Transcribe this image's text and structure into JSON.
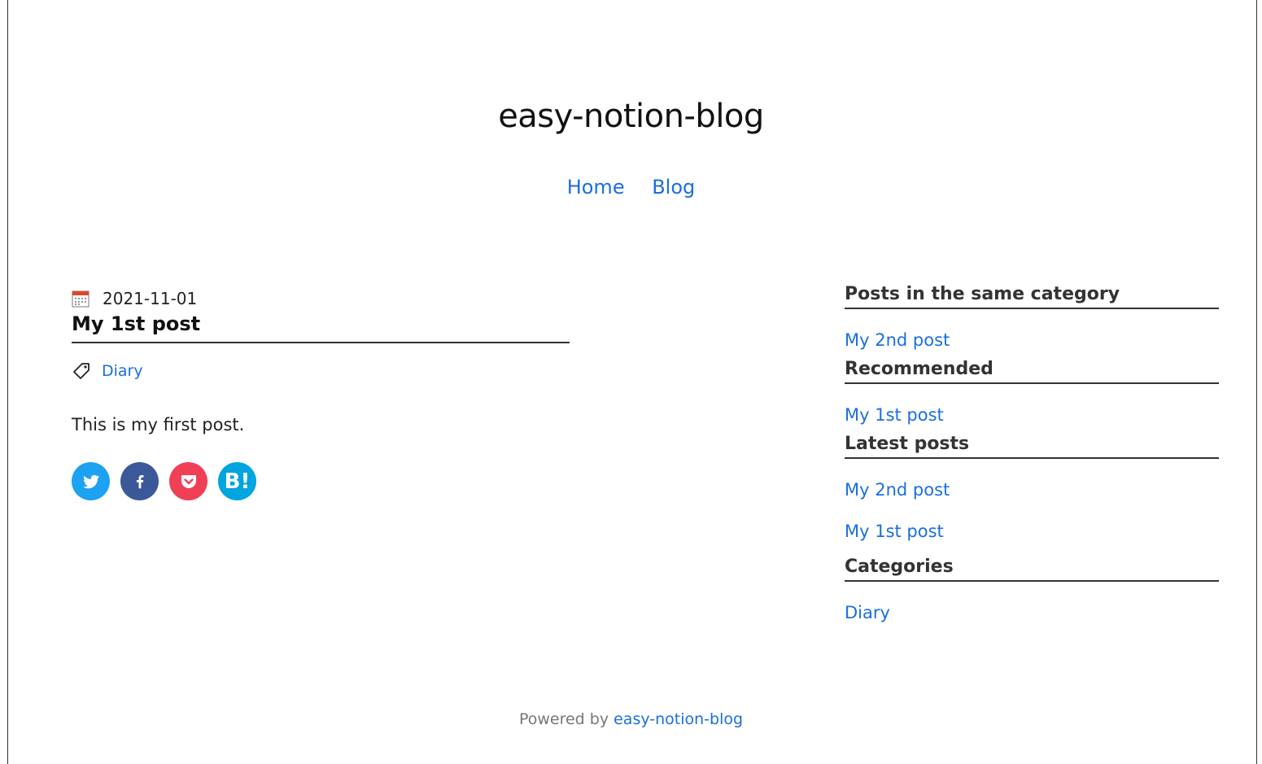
{
  "site": {
    "title": "easy-notion-blog"
  },
  "nav": {
    "items": [
      {
        "label": "Home"
      },
      {
        "label": "Blog"
      }
    ]
  },
  "post": {
    "date": "2021-11-01",
    "title": "My 1st post",
    "tag": "Diary",
    "body": "This is my first post.",
    "share": [
      {
        "name": "twitter",
        "glyph": ""
      },
      {
        "name": "facebook",
        "glyph": "f"
      },
      {
        "name": "pocket",
        "glyph": ""
      },
      {
        "name": "hatena",
        "glyph": "B!"
      }
    ]
  },
  "sidebar": {
    "same_category": {
      "heading": "Posts in the same category",
      "items": [
        "My 2nd post"
      ]
    },
    "recommended": {
      "heading": "Recommended",
      "items": [
        "My 1st post"
      ]
    },
    "latest": {
      "heading": "Latest posts",
      "items": [
        "My 2nd post",
        "My 1st post"
      ]
    },
    "categories": {
      "heading": "Categories",
      "items": [
        "Diary"
      ]
    }
  },
  "footer": {
    "prefix": "Powered by",
    "link": "easy-notion-blog"
  },
  "colors": {
    "link": "#1a6fe0",
    "twitter": "#1da1f2",
    "facebook": "#3b5998",
    "pocket": "#ef4056",
    "hatena": "#00a4de"
  }
}
